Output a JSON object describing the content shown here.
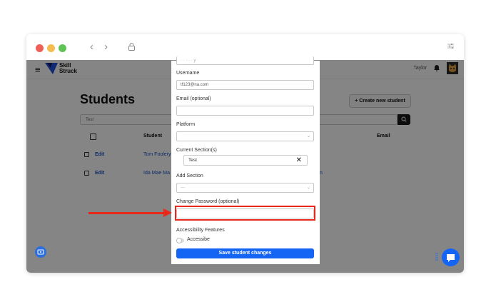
{
  "window": {
    "nav_back": "‹",
    "nav_forward": "›",
    "icons": [
      "lock-icon",
      "sliders-icon"
    ]
  },
  "appbar": {
    "brand_line1": "Skill",
    "brand_line2": "Struck",
    "user_name": "Taylor"
  },
  "page": {
    "title": "Students",
    "add_button": "+  Create new student",
    "search_value": "Test"
  },
  "table": {
    "headers": [
      "Student",
      "Email"
    ],
    "rows": [
      {
        "action": "Edit",
        "name": "Tom Foolery"
      },
      {
        "action": "Edit",
        "name": "Ida Mae Ma"
      }
    ],
    "trailing_fragment": "n"
  },
  "modal": {
    "top_field_partial": "· · · · · y",
    "username_label": "Username",
    "username_value": "tf123@na.com",
    "email_label": "Email (optional)",
    "email_value": "",
    "platform_label": "Platform",
    "platform_value": "",
    "current_sections_label": "Current Section(s)",
    "current_section_chip": "Test",
    "add_section_label": "Add Section",
    "add_section_value": "---",
    "change_password_label": "Change Password (optional)",
    "change_password_value": "",
    "accessibility_label": "Accessibility Features",
    "accessibe_label": "Accessibe",
    "save_button": "Save student changes"
  },
  "colors": {
    "primary": "#1565f5",
    "annotation": "#e8281b",
    "overlay": "rgba(0,0,0,0.48)"
  }
}
